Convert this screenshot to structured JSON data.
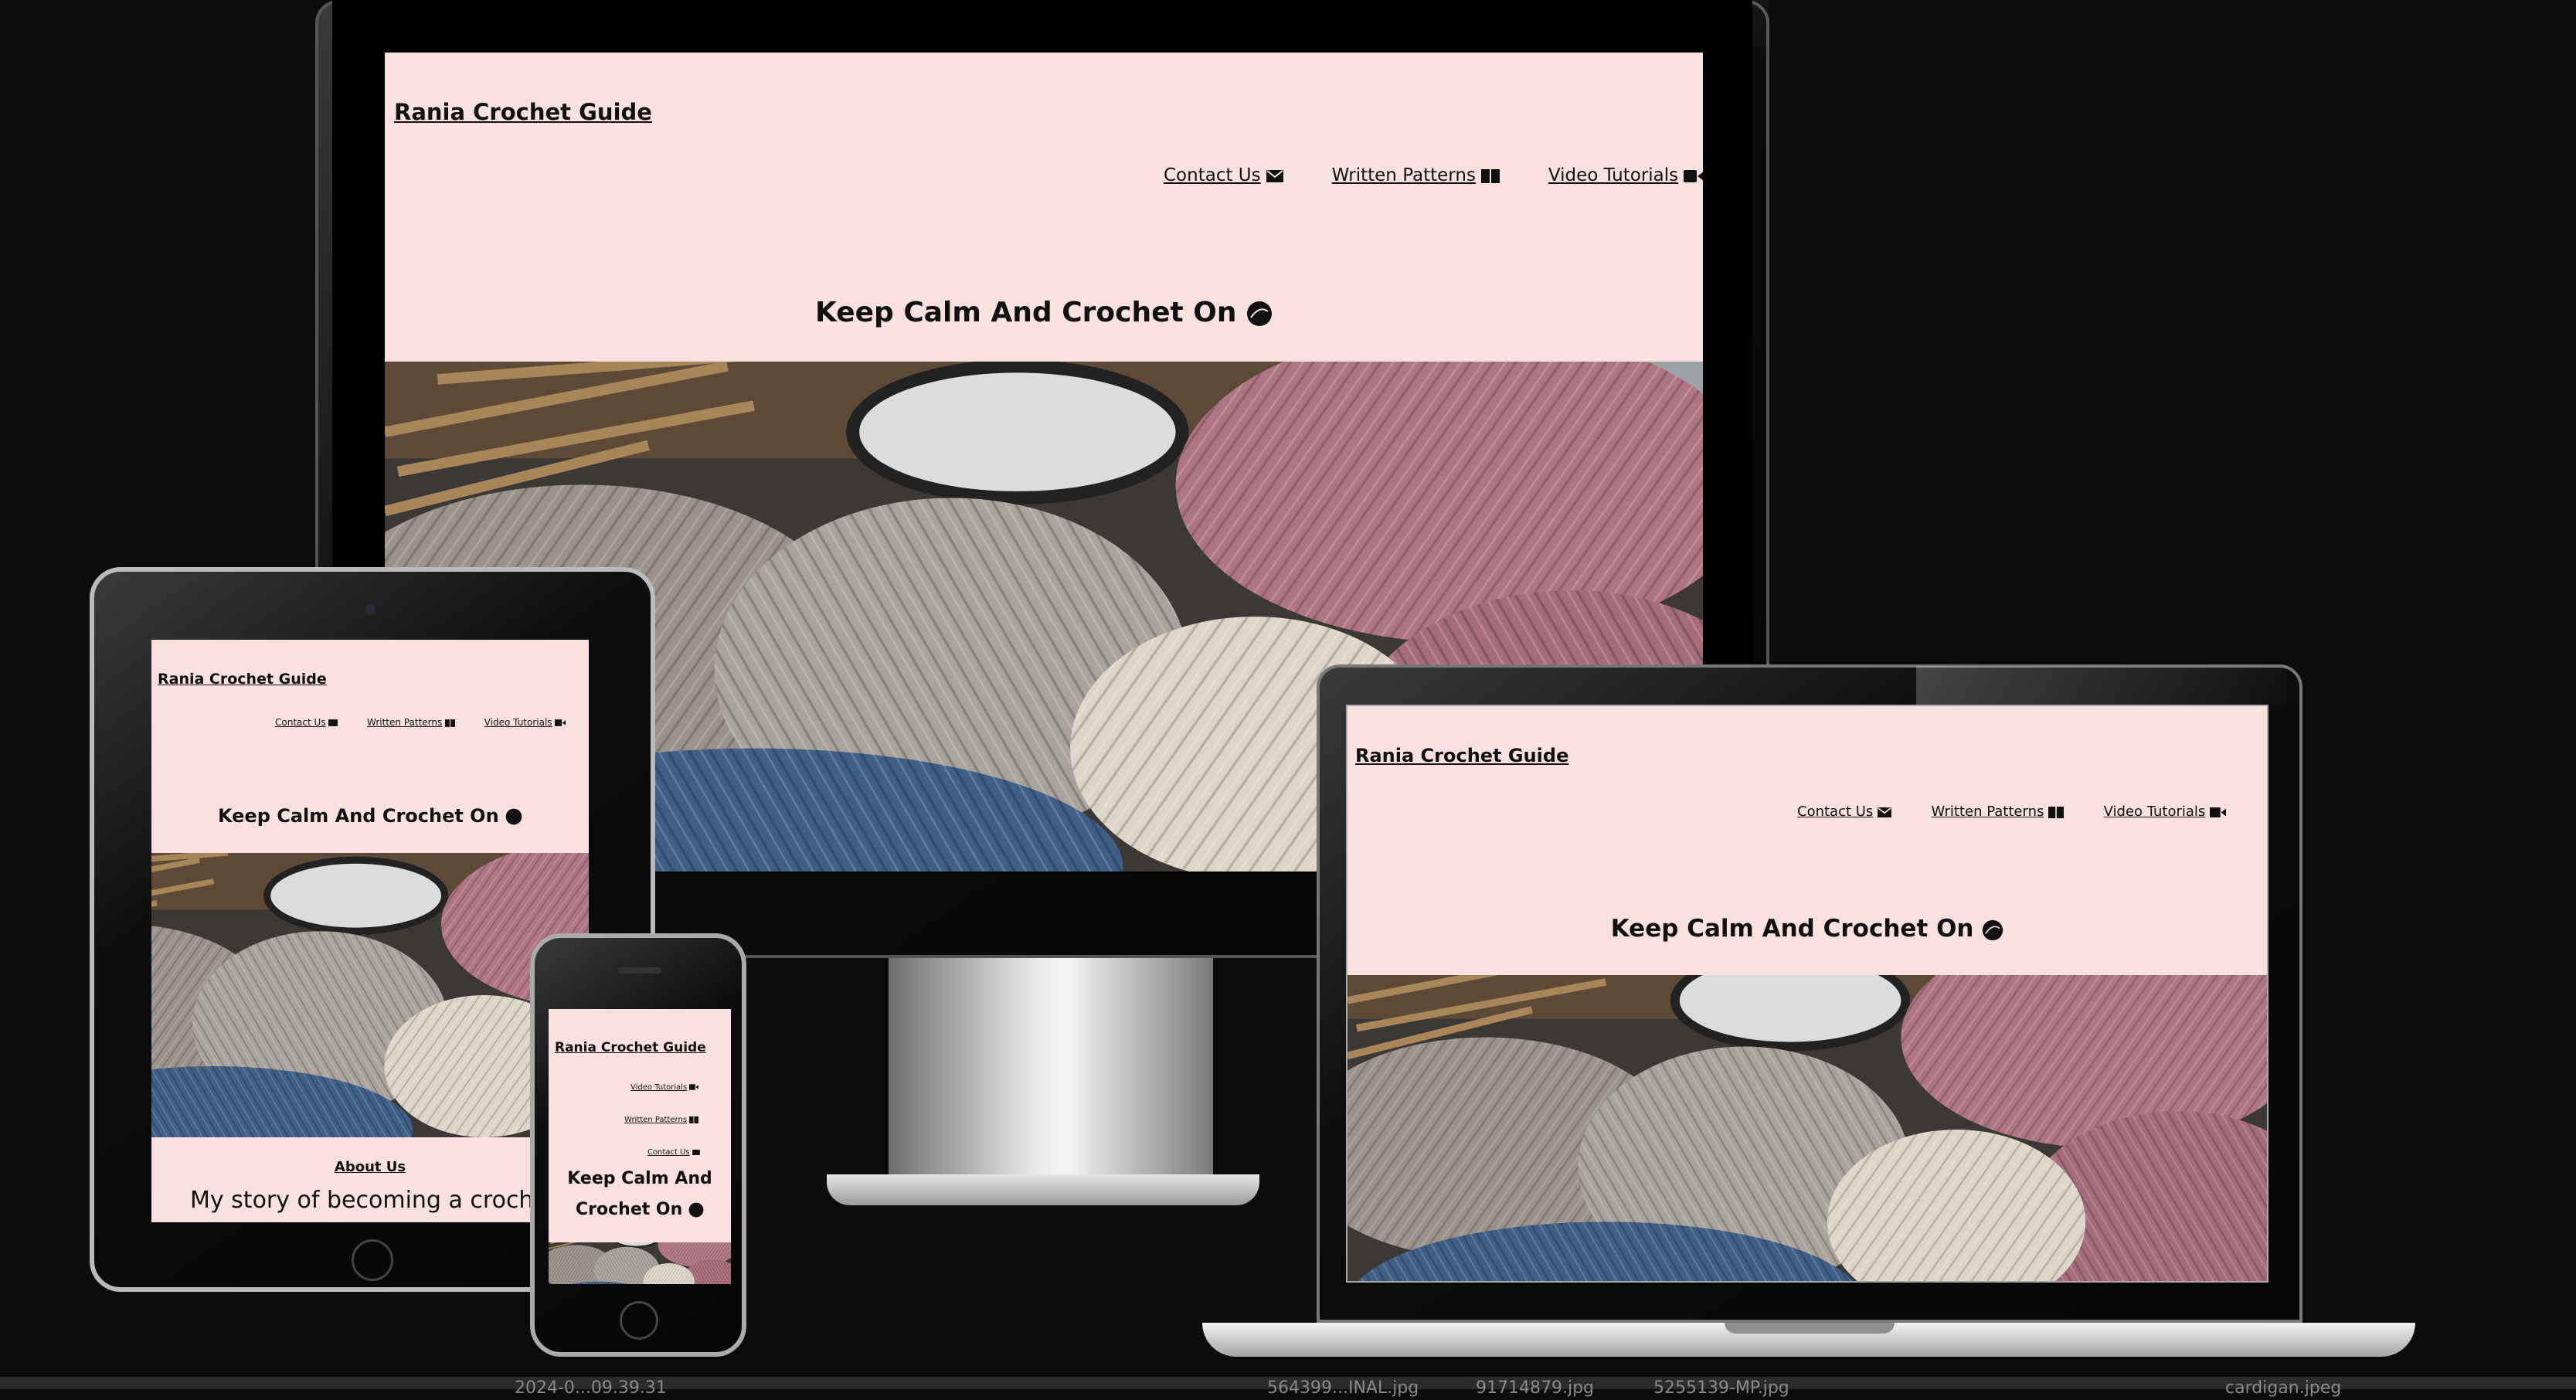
{
  "site": {
    "brand": "Rania Crochet Guide",
    "hero_title": "Keep Calm And Crochet On",
    "hero_title_line1": "Keep Calm And",
    "hero_title_line2": "Crochet On",
    "nav": [
      {
        "label": "Contact Us",
        "icon": "envelope-icon"
      },
      {
        "label": "Written Patterns",
        "icon": "book-icon"
      },
      {
        "label": "Video Tutorials",
        "icon": "video-camera-icon"
      }
    ],
    "about_heading": "About Us",
    "about_text": "My story of becoming a croche"
  },
  "bottom_bar": {
    "items": [
      "2024-0...09.39.31",
      "564399...INAL.jpg",
      "91714879.jpg",
      "5255139-MP.jpg",
      "cardigan.jpeg"
    ]
  },
  "colors": {
    "page_background": "#f9e1e0",
    "text": "#111111",
    "backdrop": "#0c0c0c"
  }
}
